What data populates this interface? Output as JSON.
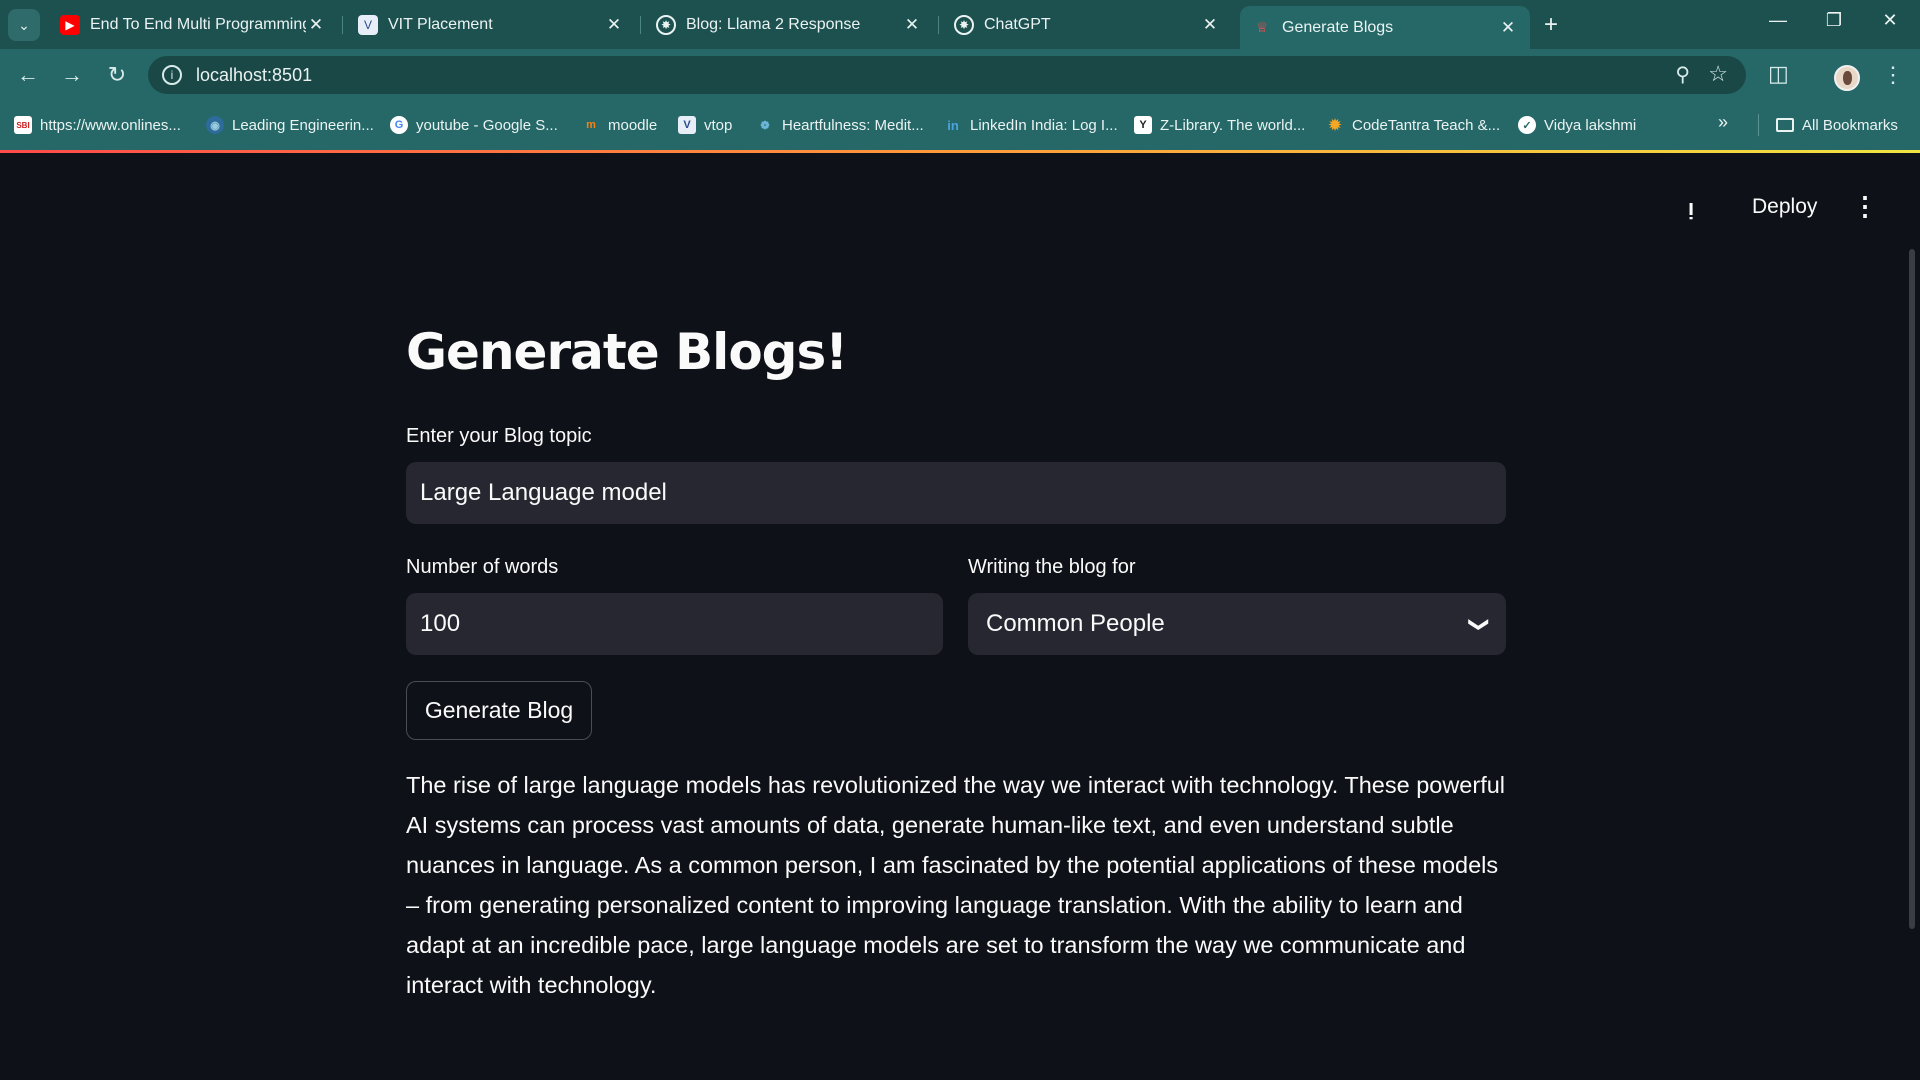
{
  "browser": {
    "tabs": [
      {
        "title": "End To End Multi Programming",
        "icon": "youtube-icon"
      },
      {
        "title": "VIT Placement",
        "icon": "vit-icon"
      },
      {
        "title": "Blog: Llama 2 Response",
        "icon": "chatgpt-icon"
      },
      {
        "title": "ChatGPT",
        "icon": "chatgpt-icon"
      },
      {
        "title": "Generate Blogs",
        "icon": "streamlit-icon"
      }
    ],
    "address": "localhost:8501",
    "bookmarks": [
      {
        "label": "https://www.onlines...",
        "icon": "sbl-icon"
      },
      {
        "label": "Leading Engineerin...",
        "icon": "globe-icon"
      },
      {
        "label": "youtube - Google S...",
        "icon": "google-icon"
      },
      {
        "label": "moodle",
        "icon": "moodle-icon"
      },
      {
        "label": "vtop",
        "icon": "vtop-icon"
      },
      {
        "label": "Heartfulness: Medit...",
        "icon": "heartfulness-icon"
      },
      {
        "label": "LinkedIn India: Log I...",
        "icon": "linkedin-icon"
      },
      {
        "label": "Z-Library. The world...",
        "icon": "zlibrary-icon"
      },
      {
        "label": "CodeTantra Teach &...",
        "icon": "codetantra-icon"
      },
      {
        "label": "Vidya lakshmi",
        "icon": "vidya-icon"
      }
    ],
    "all_bookmarks": "All Bookmarks"
  },
  "app": {
    "header": {
      "deploy": "Deploy"
    },
    "title": "Generate Blogs!",
    "topic": {
      "label": "Enter your Blog topic",
      "value": "Large Language model"
    },
    "words": {
      "label": "Number of words",
      "value": "100"
    },
    "audience": {
      "label": "Writing the blog for",
      "value": "Common People"
    },
    "generate_button": "Generate Blog",
    "output": "The rise of large language models has revolutionized the way we interact with technology. These powerful AI systems can process vast amounts of data, generate human-like text, and even understand subtle nuances in language. As a common person, I am fascinated by the potential applications of these models – from generating personalized content to improving language translation. With the ability to learn and adapt at an incredible pace, large language models are set to transform the way we communicate and interact with technology."
  }
}
